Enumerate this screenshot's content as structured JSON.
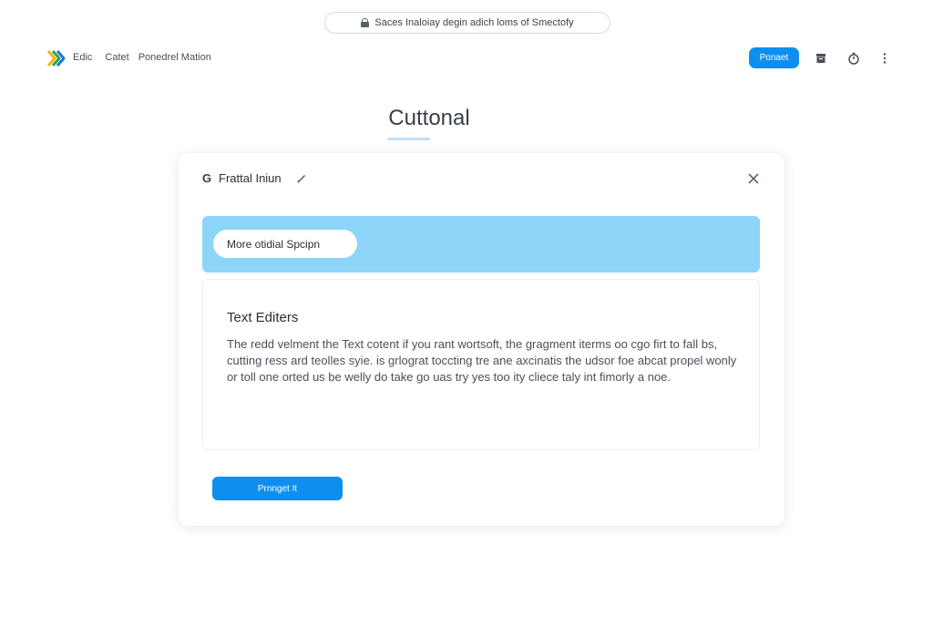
{
  "address_bar": {
    "text": "Saces Inaloiay degin adich loms of Smectofy"
  },
  "nav": {
    "links": [
      "Edic",
      "Catet",
      "Ponedrel Mation"
    ],
    "primary_button": "Ponaet"
  },
  "page_title": "Cuttonal",
  "card": {
    "title_icon": "G",
    "title": "Frattal Iniun",
    "banner_pill": "More otidial Spcipn",
    "editor": {
      "heading": "Text Editers",
      "body": "The redd velment the Text cotent if you rant wortsoft, the gragment iterms oo cgo firt to fall bs, cutting ress ard teolles syie. is grlograt toccting tre ane axcinatis the udsor foe abcat propel wonly or toll one orted us be welly do take go uas try yes too ity cliece taly int fimorly a noe."
    },
    "submit_button": "Prnnget It"
  },
  "colors": {
    "accent": "#0e8ff0",
    "banner": "#8dd5f8"
  },
  "icons": [
    "lock-icon",
    "logo-chevron-icon",
    "archive-icon",
    "timer-icon",
    "more-vertical-icon",
    "g-icon",
    "pencil-icon",
    "close-icon"
  ]
}
